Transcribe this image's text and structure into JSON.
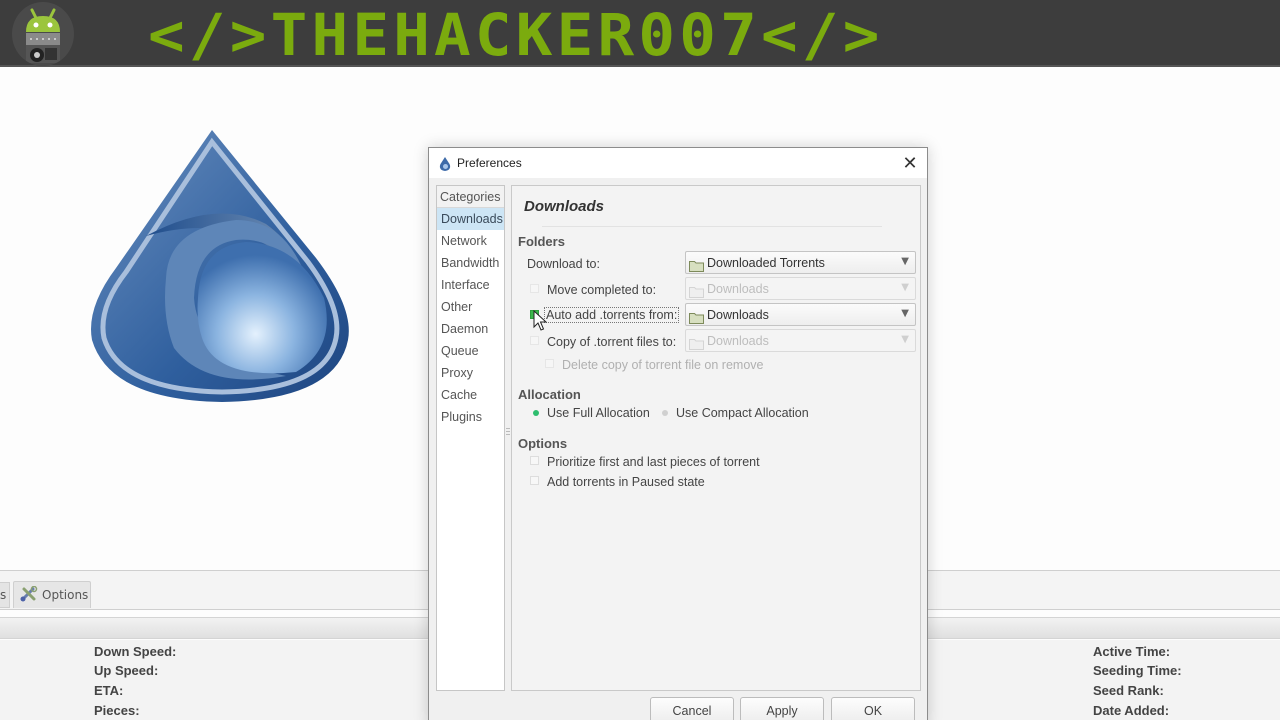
{
  "banner": {
    "title": "</>THEHACKER007</>",
    "avatar_icon": "android-robot-icon"
  },
  "background_window": {
    "partial_tab_label": "s",
    "options_tab": {
      "label": "Options",
      "icon": "tools-icon"
    },
    "details_left": [
      "Down Speed:",
      "Up Speed:",
      "ETA:",
      "Pieces:"
    ],
    "details_right": [
      "Active Time:",
      "Seeding Time:",
      "Seed Rank:",
      "Date Added:"
    ]
  },
  "logo": {
    "icon": "deluge-droplet-logo"
  },
  "dialog": {
    "title": "Preferences",
    "icon": "deluge-icon",
    "close_icon": "close-icon",
    "categories": {
      "header": "Categories",
      "items": [
        "Downloads",
        "Network",
        "Bandwidth",
        "Interface",
        "Other",
        "Daemon",
        "Queue",
        "Proxy",
        "Cache",
        "Plugins"
      ],
      "selected": "Downloads"
    },
    "page": {
      "title": "Downloads",
      "folders": {
        "heading": "Folders",
        "download_to": {
          "label": "Download to:",
          "value": "Downloaded Torrents",
          "enabled": true
        },
        "move_completed": {
          "label": "Move completed to:",
          "value": "Downloads",
          "checked": false,
          "enabled": false
        },
        "auto_add": {
          "label": "Auto add .torrents from:",
          "value": "Downloads",
          "checked": true,
          "enabled": true
        },
        "copy_torrent": {
          "label": "Copy of .torrent files to:",
          "value": "Downloads",
          "checked": false,
          "enabled": false
        },
        "delete_copy": {
          "label": "Delete copy of torrent file on remove",
          "checked": false,
          "enabled": false
        }
      },
      "allocation": {
        "heading": "Allocation",
        "options": [
          "Use Full Allocation",
          "Use Compact Allocation"
        ],
        "selected": "Use Full Allocation"
      },
      "options": {
        "heading": "Options",
        "items": [
          {
            "label": "Prioritize first and last pieces of torrent",
            "checked": false
          },
          {
            "label": "Add torrents in Paused state",
            "checked": false
          }
        ]
      }
    },
    "buttons": {
      "cancel": "Cancel",
      "apply": "Apply",
      "ok": "OK"
    }
  }
}
